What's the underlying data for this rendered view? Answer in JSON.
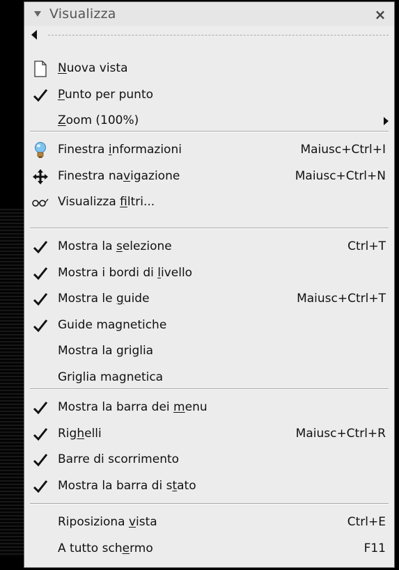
{
  "menu": {
    "title": "Visualizza",
    "close_glyph": "×",
    "groups": [
      [
        {
          "label_pre": "",
          "mn": "N",
          "label_post": "uova vista",
          "accel": "",
          "icon": "document-icon",
          "checked": false,
          "submenu": false
        },
        {
          "label_pre": "",
          "mn": "P",
          "label_post": "unto per punto",
          "accel": "",
          "icon": "",
          "checked": true,
          "submenu": false
        },
        {
          "label_pre": "",
          "mn": "Z",
          "label_post": "oom (100%)",
          "accel": "",
          "icon": "",
          "checked": false,
          "submenu": true
        }
      ],
      [
        {
          "label_pre": "Finestra ",
          "mn": "i",
          "label_post": "nformazioni",
          "accel": "Maiusc+Ctrl+I",
          "icon": "lightbulb-icon",
          "checked": false,
          "submenu": false
        },
        {
          "label_pre": "Finestra na",
          "mn": "v",
          "label_post": "igazione",
          "accel": "Maiusc+Ctrl+N",
          "icon": "move-arrows-icon",
          "checked": false,
          "submenu": false
        },
        {
          "label_pre": "Visualizza ",
          "mn": "f",
          "label_post": "iltri...",
          "accel": "",
          "icon": "glasses-icon",
          "checked": false,
          "submenu": false
        }
      ],
      [
        {
          "label_pre": "Mostra la ",
          "mn": "s",
          "label_post": "elezione",
          "accel": "Ctrl+T",
          "icon": "",
          "checked": true,
          "submenu": false
        },
        {
          "label_pre": "Mostra i bordi di ",
          "mn": "l",
          "label_post": "ivello",
          "accel": "",
          "icon": "",
          "checked": true,
          "submenu": false
        },
        {
          "label_pre": "Mostra le ",
          "mn": "g",
          "label_post": "uide",
          "accel": "Maiusc+Ctrl+T",
          "icon": "",
          "checked": true,
          "submenu": false
        },
        {
          "label_pre": "Guide magnetiche",
          "mn": "",
          "label_post": "",
          "accel": "",
          "icon": "",
          "checked": true,
          "submenu": false
        },
        {
          "label_pre": "Mostra la griglia",
          "mn": "",
          "label_post": "",
          "accel": "",
          "icon": "",
          "checked": false,
          "submenu": false
        },
        {
          "label_pre": "Griglia magnetica",
          "mn": "",
          "label_post": "",
          "accel": "",
          "icon": "",
          "checked": false,
          "submenu": false
        }
      ],
      [
        {
          "label_pre": "Mostra la barra dei ",
          "mn": "m",
          "label_post": "enu",
          "accel": "",
          "icon": "",
          "checked": true,
          "submenu": false
        },
        {
          "label_pre": "Rig",
          "mn": "h",
          "label_post": "elli",
          "accel": "Maiusc+Ctrl+R",
          "icon": "",
          "checked": true,
          "submenu": false
        },
        {
          "label_pre": "Barre di scorrimento",
          "mn": "",
          "label_post": "",
          "accel": "",
          "icon": "",
          "checked": true,
          "submenu": false
        },
        {
          "label_pre": "Mostra la barra di s",
          "mn": "t",
          "label_post": "ato",
          "accel": "",
          "icon": "",
          "checked": true,
          "submenu": false
        }
      ],
      [
        {
          "label_pre": "Riposiziona ",
          "mn": "v",
          "label_post": "ista",
          "accel": "Ctrl+E",
          "icon": "",
          "checked": false,
          "submenu": false
        },
        {
          "label_pre": "A tutto sch",
          "mn": "e",
          "label_post": "rmo",
          "accel": "F11",
          "icon": "",
          "checked": false,
          "submenu": false
        }
      ]
    ]
  }
}
